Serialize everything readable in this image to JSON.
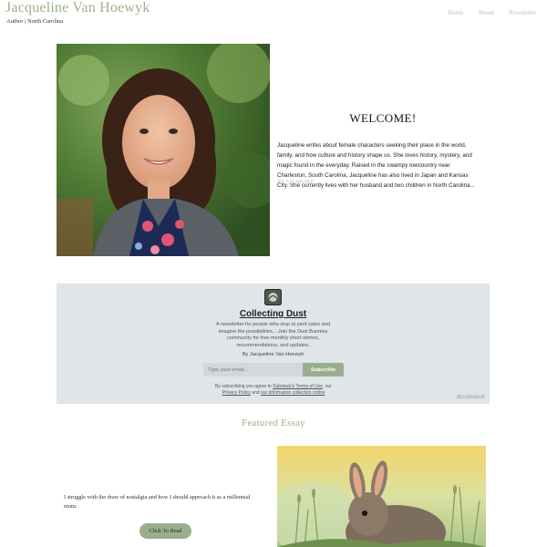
{
  "header": {
    "site_title": "Jacqueline Van Hoewyk",
    "tagline": "Author | North Carolina",
    "nav": [
      {
        "label": "Home"
      },
      {
        "label": "About"
      },
      {
        "label": "Newsletter"
      }
    ]
  },
  "hero": {
    "photo_icon": "author-portrait",
    "welcome_title": "WELCOME!",
    "body_lines": [
      "Jacqueline writes about female characters seeking their place in the world,",
      "family, and how culture and history shape us. She loves history, mystery, and",
      "magic found in the everyday. Raised in the swampy lowcountry near",
      "Charleston, South Carolina, Jacqueline has also lived in Japan and Kansas",
      "City. She currently lives with her husband and two children in North Carolina..."
    ],
    "read_more": "READ MORE"
  },
  "newsletter": {
    "title": "Collecting Dust",
    "description_lines": [
      "A newsletter for people who stop at yard sales and",
      "imagine the possibilities... Join the Dust Bunnies",
      "community for free monthly short stories,",
      "recommendations, and updates."
    ],
    "author": "By Jacqueline Van Hoewyk",
    "email_placeholder": "Type your email...",
    "subscribe_label": "Subscribe",
    "terms_prefix": "By subscribing you agree to ",
    "terms_link": "Substack's Terms of Use",
    "terms_mid": ", our",
    "privacy_link": "Privacy Policy",
    "terms_and": " and ",
    "collection_link": "our information collection notice",
    "badge": "substack",
    "accent_color": "#9aae8e"
  },
  "featured": {
    "title": "Featured Essay",
    "excerpt_lines": [
      "I struggle with the draw of nostalgia and how I should approach it as a millennial",
      "mom."
    ],
    "button_label": "Click To Read",
    "photo_icon": "rabbit-photo"
  },
  "colors": {
    "brand_green": "#9bb08e",
    "nav_text": "#b9c4b2",
    "newsletter_bg": "#dfe5e8"
  }
}
